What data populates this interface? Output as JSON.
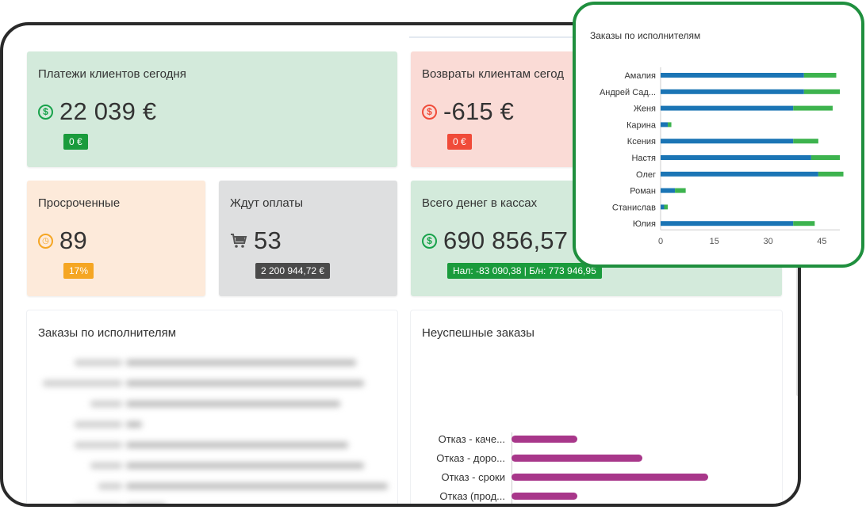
{
  "cards": {
    "payments": {
      "title": "Платежи клиентов сегодня",
      "value": "22 039 €",
      "badge": "0 €"
    },
    "refunds": {
      "title": "Возвраты клиентам сегод",
      "value": "-615 €",
      "badge": "0 €"
    },
    "overdue": {
      "title": "Просроченные",
      "value": "89",
      "badge": "17%"
    },
    "awaiting": {
      "title": "Ждут оплаты",
      "value": "53",
      "badge": "2 200 944,72 €"
    },
    "cash": {
      "title": "Всего денег в кассах",
      "value": "690 856,57",
      "badge": "Нал: -83 090,38 | Б/н: 773 946,95"
    }
  },
  "orders_panel": {
    "title": "Заказы по исполнителям"
  },
  "failed_panel": {
    "title": "Неуспешные заказы",
    "chart_data": {
      "type": "bar",
      "orientation": "horizontal",
      "categories": [
        "Отказ - каче...",
        "Отказ - доро...",
        "Отказ - сроки",
        "Отказ (прод..."
      ],
      "values": [
        11,
        22,
        33,
        11
      ],
      "color": "#a8378a"
    }
  },
  "zoom_panel": {
    "title": "Заказы по исполнителям",
    "chart_data": {
      "type": "bar",
      "orientation": "horizontal",
      "stacked": true,
      "categories": [
        "Амалия",
        "Андрей Сад...",
        "Женя",
        "Карина",
        "Ксения",
        "Настя",
        "Олег",
        "Роман",
        "Станислав",
        "Юлия"
      ],
      "series": [
        {
          "values": [
            40,
            40,
            37,
            2,
            37,
            42,
            44,
            4,
            1,
            37
          ],
          "color": "#1b75b5"
        },
        {
          "values": [
            9,
            10,
            11,
            1,
            7,
            8,
            7,
            3,
            1,
            6
          ],
          "color": "#3db34e"
        }
      ],
      "xticks": [
        "0",
        "15",
        "30",
        "45"
      ],
      "xlim": [
        0,
        50
      ]
    }
  },
  "colors": {
    "green_badge": "#1a9b3c",
    "red_badge": "#f04b39",
    "orange_badge": "#f5a623",
    "dark_badge": "#4a4a4a",
    "green_icon": "#17a24a",
    "red_icon": "#f04b39",
    "orange_icon": "#f5a623"
  }
}
